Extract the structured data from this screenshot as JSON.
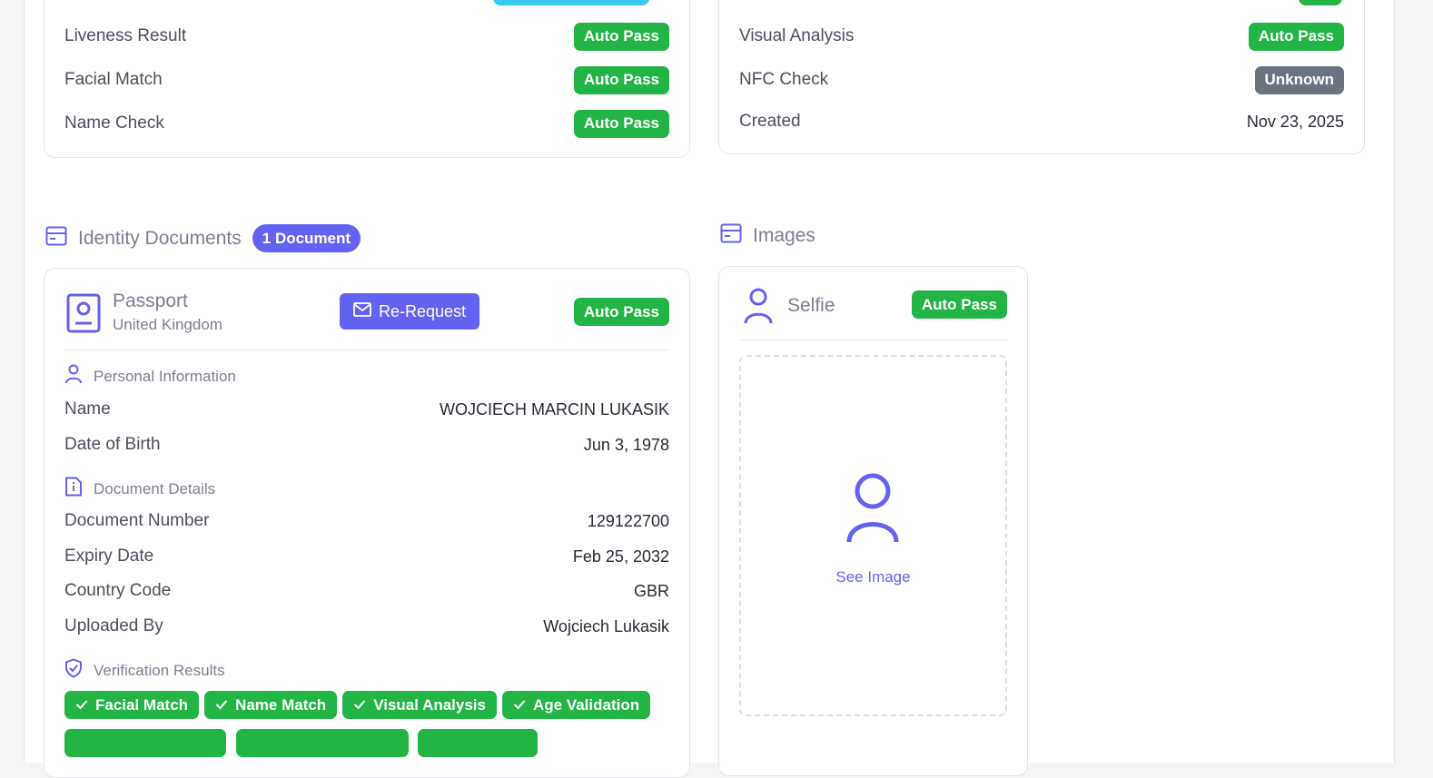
{
  "top_left_card": {
    "rows": [
      {
        "label": "Liveness Result",
        "status": "Auto Pass"
      },
      {
        "label": "Facial Match",
        "status": "Auto Pass"
      },
      {
        "label": "Name Check",
        "status": "Auto Pass"
      }
    ]
  },
  "top_right_card": {
    "rows": [
      {
        "label": "Visual Analysis",
        "status": "Auto Pass"
      },
      {
        "label": "NFC Check",
        "status": "Unknown"
      },
      {
        "label": "Created",
        "value": "Nov 23, 2025"
      }
    ]
  },
  "identity_documents": {
    "title": "Identity Documents",
    "count_badge": "1 Document",
    "document": {
      "type": "Passport",
      "country": "United Kingdom",
      "re_request_label": "Re-Request",
      "status": "Auto Pass",
      "personal_info": {
        "heading": "Personal Information",
        "rows": [
          {
            "label": "Name",
            "value": "WOJCIECH MARCIN LUKASIK"
          },
          {
            "label": "Date of Birth",
            "value": "Jun 3, 1978"
          }
        ]
      },
      "document_details": {
        "heading": "Document Details",
        "rows": [
          {
            "label": "Document Number",
            "value": "129122700"
          },
          {
            "label": "Expiry Date",
            "value": "Feb 25, 2032"
          },
          {
            "label": "Country Code",
            "value": "GBR"
          },
          {
            "label": "Uploaded By",
            "value": "Wojciech Lukasik"
          }
        ]
      },
      "verification_results": {
        "heading": "Verification Results",
        "chips": [
          "Facial Match",
          "Name Match",
          "Visual Analysis",
          "Age Validation"
        ]
      }
    }
  },
  "images": {
    "title": "Images",
    "selfie": {
      "label": "Selfie",
      "status": "Auto Pass",
      "see_image_label": "See Image"
    }
  },
  "colors": {
    "accent": "#6462f0",
    "pass_green": "#22b445",
    "unknown_grey": "#6b7280",
    "info_cyan": "#38c7ef"
  },
  "icons": [
    "card-icon",
    "passport-icon",
    "mail-icon",
    "user-icon",
    "document-info-icon",
    "shield-check-icon",
    "check-icon"
  ]
}
